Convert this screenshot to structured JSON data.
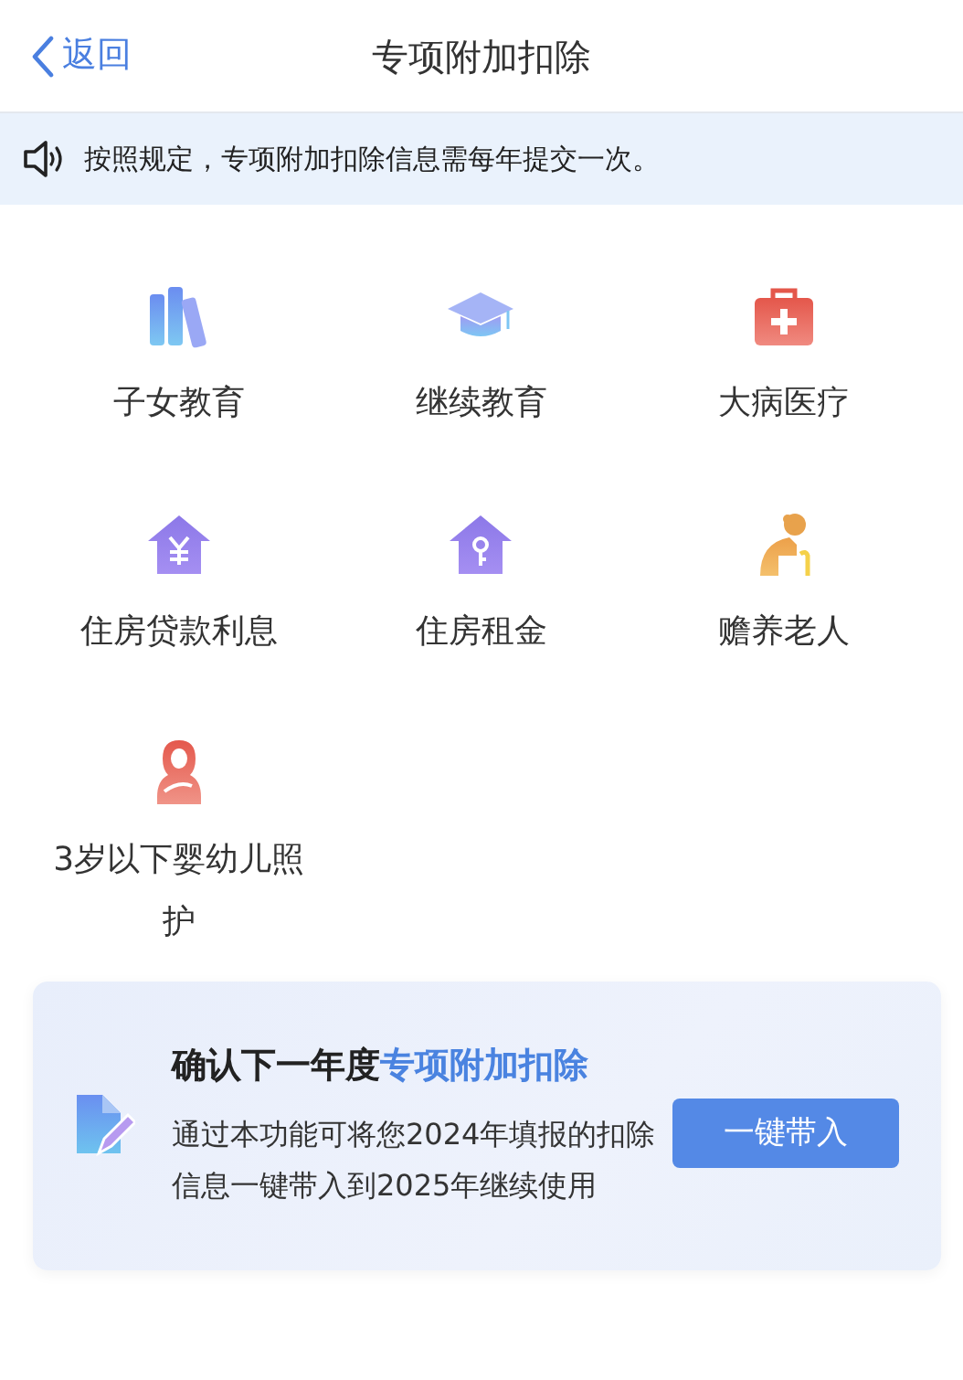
{
  "nav": {
    "back": "返回",
    "title": "专项附加扣除"
  },
  "notice": "按照规定，专项附加扣除信息需每年提交一次。",
  "categories": [
    {
      "label": "子女教育"
    },
    {
      "label": "继续教育"
    },
    {
      "label": "大病医疗"
    },
    {
      "label": "住房贷款利息"
    },
    {
      "label": "住房租金"
    },
    {
      "label": "赡养老人"
    },
    {
      "label": "3岁以下婴幼儿照护"
    }
  ],
  "promo": {
    "title": "确认下一年度**专项附加扣除**",
    "description": "通过本功能可将您2024年填报的扣除信息一键带入到2025年继续使用",
    "button": "一键带入"
  }
}
